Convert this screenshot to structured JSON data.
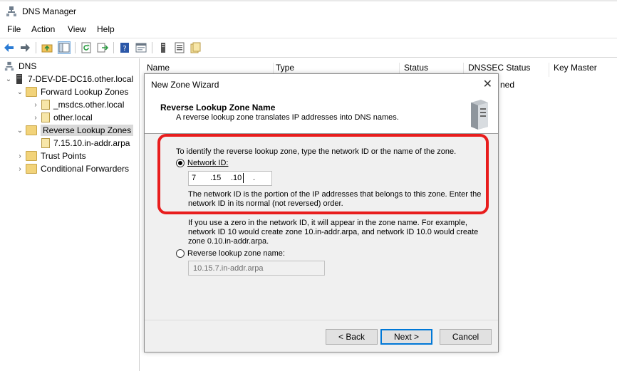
{
  "window": {
    "title": "DNS Manager"
  },
  "menu": {
    "items": [
      "File",
      "Action",
      "View",
      "Help"
    ]
  },
  "toolbar": {
    "icons": [
      "back-arrow-icon",
      "forward-arrow-icon",
      "up-folder-icon",
      "show-tree-icon",
      "refresh-icon",
      "export-icon",
      "help-icon",
      "properties-icon",
      "server-icon",
      "list-icon",
      "zone-icon"
    ]
  },
  "tree": {
    "root": "DNS",
    "server": "7-DEV-DE-DC16.other.local",
    "forward": "Forward Lookup Zones",
    "fwd_child1": "_msdcs.other.local",
    "fwd_child2": "other.local",
    "reverse": "Reverse Lookup Zones",
    "rev_child1": "7.15.10.in-addr.arpa",
    "trust": "Trust Points",
    "conditional": "Conditional Forwarders"
  },
  "list": {
    "columns": [
      "Name",
      "Type",
      "Status",
      "DNSSEC Status",
      "Key Master"
    ],
    "partial_cell": "ned"
  },
  "dialog": {
    "title": "New Zone Wizard",
    "close": "✕",
    "header": "Reverse Lookup Zone Name",
    "subheader": "A reverse lookup zone translates IP addresses into DNS names.",
    "intro": "To identify the reverse lookup zone, type the network ID or the name of the zone.",
    "network_id_label": "Network ID:",
    "network_id": {
      "o1": "7",
      "o2": ".15",
      "o3": ".10",
      "o4": "."
    },
    "explain1": "The network ID is the portion of the IP addresses that belongs to this zone. Enter the",
    "explain2": "network ID in its normal (not reversed) order.",
    "zero1": "If you use a zero in the network ID, it will appear in the zone name. For example,",
    "zero2": "network ID 10 would create zone 10.in-addr.arpa, and network ID 10.0 would create",
    "zero3": "zone 0.10.in-addr.arpa.",
    "reverse_name_label": "Reverse lookup zone name:",
    "reverse_name_value": "10.15.7.in-addr.arpa",
    "buttons": {
      "back": "< Back",
      "next": "Next >",
      "cancel": "Cancel"
    }
  },
  "colors": {
    "annotation": "#e81d1d",
    "accent": "#0078d7"
  }
}
